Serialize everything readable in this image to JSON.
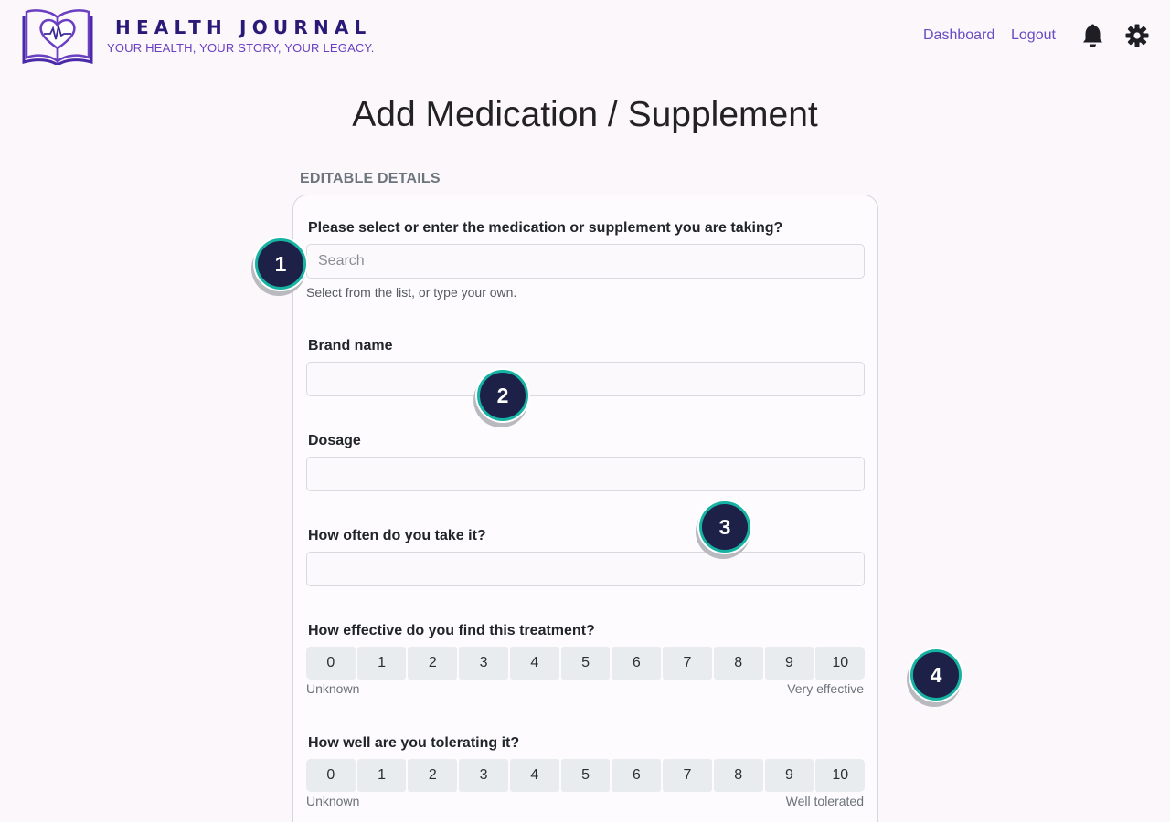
{
  "header": {
    "title": "HEALTH JOURNAL",
    "tagline": "YOUR HEALTH, YOUR STORY, YOUR LEGACY.",
    "nav": {
      "dashboard": "Dashboard",
      "logout": "Logout"
    },
    "icons": {
      "logo": "book-heart-logo",
      "notifications": "bell-icon",
      "settings": "gear-icon"
    }
  },
  "page": {
    "title": "Add Medication / Supplement",
    "section_label": "EDITABLE DETAILS"
  },
  "form": {
    "medication": {
      "label": "Please select or enter the medication or supplement you are taking?",
      "placeholder": "Search",
      "value": "",
      "help": "Select from the list, or type your own."
    },
    "brand": {
      "label": "Brand name",
      "value": ""
    },
    "dosage": {
      "label": "Dosage",
      "value": ""
    },
    "frequency": {
      "label": "How often do you take it?",
      "value": ""
    },
    "effectiveness": {
      "label": "How effective do you find this treatment?",
      "options": [
        "0",
        "1",
        "2",
        "3",
        "4",
        "5",
        "6",
        "7",
        "8",
        "9",
        "10"
      ],
      "min_label": "Unknown",
      "max_label": "Very effective"
    },
    "tolerance": {
      "label": "How well are you tolerating it?",
      "options": [
        "0",
        "1",
        "2",
        "3",
        "4",
        "5",
        "6",
        "7",
        "8",
        "9",
        "10"
      ],
      "min_label": "Unknown",
      "max_label": "Well tolerated"
    }
  },
  "badges": [
    "1",
    "2",
    "3",
    "4"
  ],
  "colors": {
    "background": "#fbf7fb",
    "brand": "#2a1a78",
    "accent": "#6a4bc4",
    "badge_fill": "#1d2148",
    "badge_ring": "#16b3a3"
  }
}
